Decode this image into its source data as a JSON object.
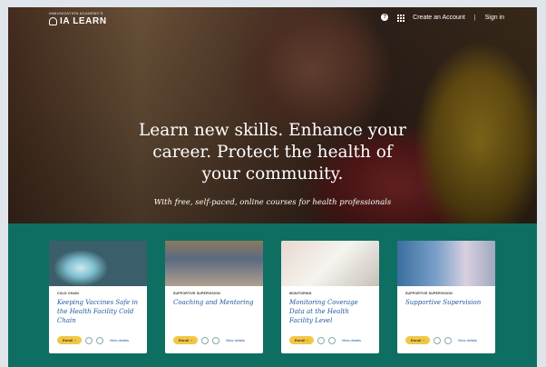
{
  "header": {
    "logo_small": "IMMUNIZATION ACADEMY'S",
    "logo_main": "IA LEARN",
    "help_icon": "question-circle-icon",
    "apps_icon": "grid-icon",
    "create_account": "Create an Account",
    "separator": "|",
    "sign_in": "Sign in"
  },
  "hero": {
    "title": "Learn new skills. Enhance your career. Protect the health of your community.",
    "subtitle": "With free, self-paced, online courses for health professionals"
  },
  "colors": {
    "teal": "#0f6e62",
    "enroll": "#f2c744",
    "title_blue": "#1d5aa0"
  },
  "cards": [
    {
      "tag": "COLD CHAIN",
      "title": "Keeping Vaccines Safe in the Health Facility Cold Chain",
      "enroll": "Enroll",
      "view": "View details"
    },
    {
      "tag": "SUPPORTIVE SUPERVISION",
      "title": "Coaching and Mentoring",
      "enroll": "Enroll",
      "view": "View details"
    },
    {
      "tag": "MONITORING",
      "title": "Monitoring Coverage Data at the Health Facility Level",
      "enroll": "Enroll",
      "view": "View details"
    },
    {
      "tag": "SUPPORTIVE SUPERVISION",
      "title": "Supportive Supervision",
      "enroll": "Enroll",
      "view": "View details"
    }
  ]
}
